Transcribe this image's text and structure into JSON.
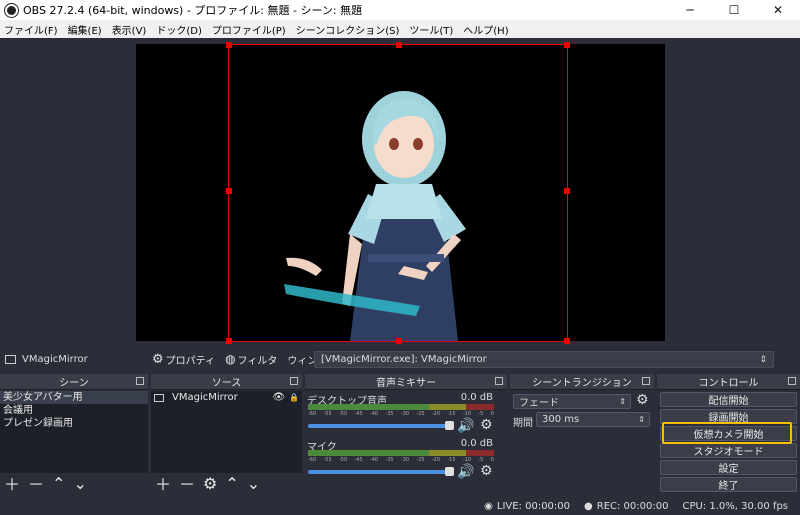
{
  "window": {
    "title": "OBS 27.2.4 (64-bit, windows) - プロファイル: 無題 - シーン: 無題",
    "minimize": "─",
    "maximize": "☐",
    "close": "✕"
  },
  "menu": [
    "ファイル(F)",
    "編集(E)",
    "表示(V)",
    "ドック(D)",
    "プロファイル(P)",
    "シーンコレクション(S)",
    "ツール(T)",
    "ヘルプ(H)"
  ],
  "source_toolbar": {
    "selected_source": "VMagicMirror",
    "properties": "プロパティ",
    "filters": "フィルタ",
    "window_label": "ウィンドウ",
    "window_value": "[VMagicMirror.exe]: VMagicMirror"
  },
  "docks": {
    "scenes": {
      "title": "シーン",
      "items": [
        "美少女アバター用",
        "会議用",
        "プレゼン録画用"
      ]
    },
    "sources": {
      "title": "ソース",
      "items": [
        "VMagicMirror"
      ]
    },
    "mixer": {
      "title": "音声ミキサー",
      "scale": [
        "-60",
        "-55",
        "-50",
        "-45",
        "-40",
        "-35",
        "-30",
        "-25",
        "-20",
        "-15",
        "-10",
        "-5",
        "0"
      ],
      "channels": [
        {
          "name": "デスクトップ音声",
          "db": "0.0 dB",
          "volume_fraction": 1.0
        },
        {
          "name": "マイク",
          "db": "0.0 dB",
          "volume_fraction": 1.0
        }
      ]
    },
    "transitions": {
      "title": "シーントランジション",
      "type": "フェード",
      "duration_label": "期間",
      "duration_value": "300 ms"
    },
    "controls": {
      "title": "コントロール",
      "buttons": [
        "配信開始",
        "録画開始",
        "仮想カメラ開始",
        "スタジオモード",
        "設定",
        "終了"
      ]
    }
  },
  "status": {
    "live": "LIVE: 00:00:00",
    "rec": "REC: 00:00:00",
    "cpu": "CPU: 1.0%, 30.00 fps"
  },
  "colors": {
    "selection": "#e00000",
    "highlight": "#f5c000",
    "volume": "#4a90e2"
  }
}
